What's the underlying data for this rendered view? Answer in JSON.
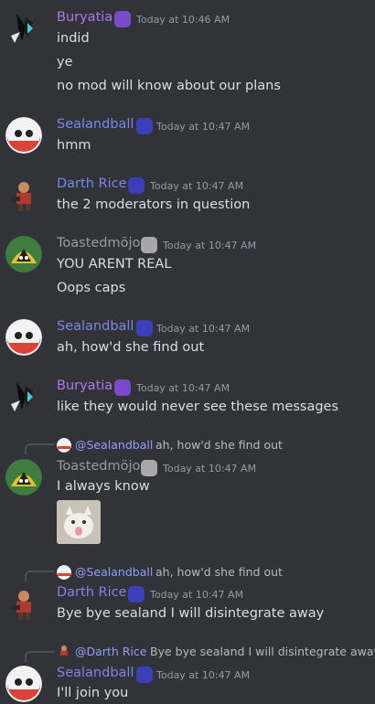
{
  "colors": {
    "background": "#313338",
    "buryatia": "#b07ae8",
    "sealandball": "#7d86e8",
    "darth_rice": "#7d86e8",
    "toastedmojo": "#9a9ba0",
    "mention": "#949cf7"
  },
  "messages": [
    {
      "user": "Buryatia",
      "time": "Today at 10:46 AM",
      "lines": [
        "indid",
        "ye",
        "no mod will know about our plans"
      ]
    },
    {
      "user": "Sealandball",
      "time": "Today at 10:47 AM",
      "lines": [
        "hmm"
      ]
    },
    {
      "user": "Darth Rice",
      "time": "Today at 10:47 AM",
      "lines": [
        "the 2 moderators in question"
      ]
    },
    {
      "user": "Toastedmöjo",
      "time": "Today at 10:47 AM",
      "lines": [
        "YOU ARENT REAL",
        "Oops caps"
      ]
    },
    {
      "user": "Sealandball",
      "time": "Today at 10:47 AM",
      "lines": [
        "ah, how'd she find out"
      ]
    },
    {
      "user": "Buryatia",
      "time": "Today at 10:47 AM",
      "lines": [
        "like they would never see these messages"
      ]
    },
    {
      "reply_to": {
        "mention": "@Sealandball",
        "text": "ah, how'd she find out"
      },
      "user": "Toastedmöjo",
      "time": "Today at 10:47 AM",
      "lines": [
        "I always know"
      ],
      "attachment": "cat-image"
    },
    {
      "reply_to": {
        "mention": "@Sealandball",
        "text": "ah, how'd she find out"
      },
      "user": "Darth Rice",
      "time": "Today at 10:47 AM",
      "lines": [
        "Bye bye sealand I will disintegrate away"
      ]
    },
    {
      "reply_to": {
        "mention": "@Darth Rice",
        "text": "Bye bye sealand I will disintegrate away"
      },
      "user": "Sealandball",
      "time": "Today at 10:47 AM",
      "lines": [
        "I'll join you"
      ]
    }
  ]
}
